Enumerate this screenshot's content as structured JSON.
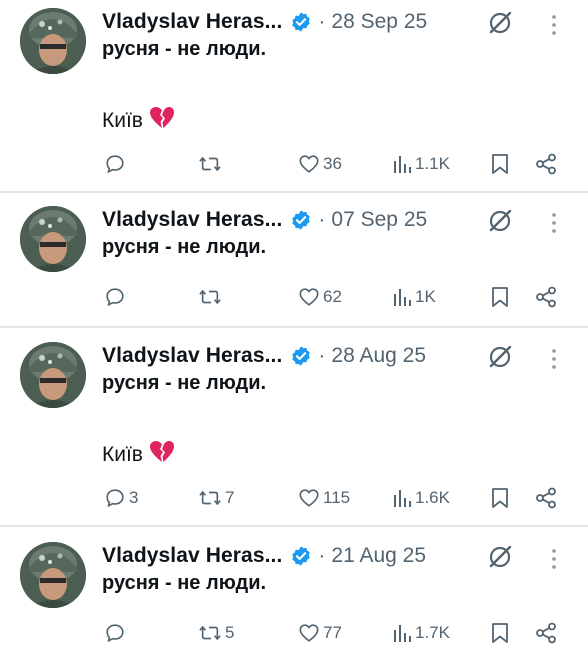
{
  "tweets": [
    {
      "author": "Vladyslav Heras...",
      "sep": "·",
      "date": "28 Sep 25",
      "text": "русня - не люди.",
      "city": "Київ",
      "emoji": "broken-heart",
      "replies": "",
      "reposts": "",
      "likes": "36",
      "views": "1.1K"
    },
    {
      "author": "Vladyslav Heras...",
      "sep": "·",
      "date": "07 Sep 25",
      "text": "русня - не люди.",
      "replies": "",
      "reposts": "",
      "likes": "62",
      "views": "1K"
    },
    {
      "author": "Vladyslav Heras...",
      "sep": "·",
      "date": "28 Aug 25",
      "text": "русня - не люди.",
      "city": "Київ",
      "emoji": "broken-heart",
      "replies": "3",
      "reposts": "7",
      "likes": "115",
      "views": "1.6K"
    },
    {
      "author": "Vladyslav Heras...",
      "sep": "·",
      "date": "21 Aug 25",
      "text": "русня - не люди.",
      "replies": "",
      "reposts": "5",
      "likes": "77",
      "views": "1.7K"
    }
  ],
  "colors": {
    "verified": "#1d9bf0",
    "muted": "#536471",
    "heart": "#e0245e",
    "divider": "#e1e6ea"
  },
  "icons": [
    "reply-icon",
    "repost-icon",
    "like-icon",
    "views-icon",
    "bookmark-icon",
    "share-icon",
    "grok-icon",
    "more-icon",
    "verified-icon"
  ]
}
